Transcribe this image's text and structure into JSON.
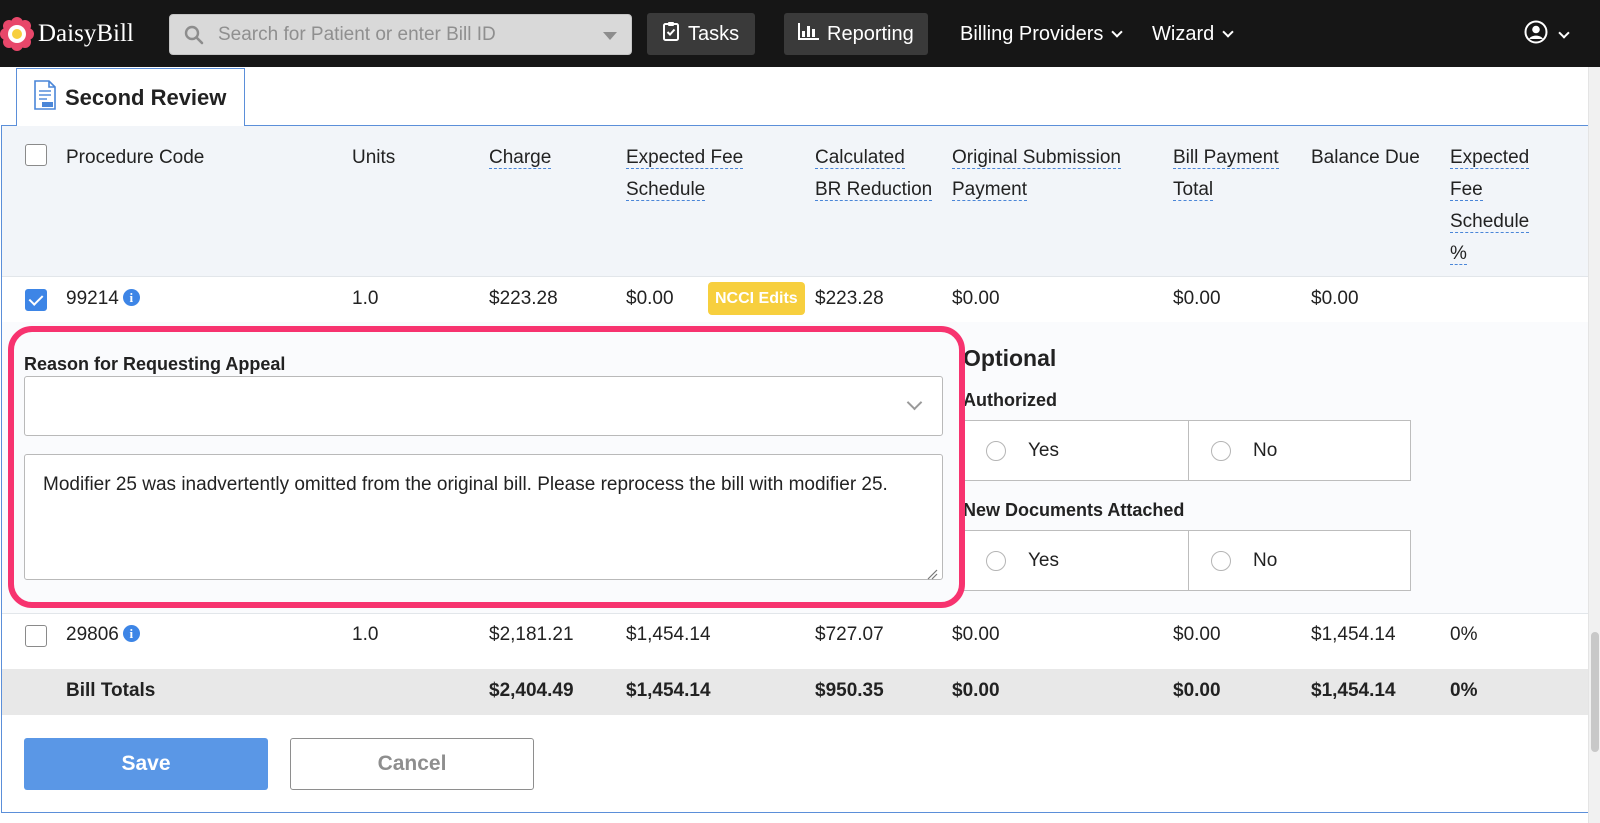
{
  "brand": {
    "name": "DaisyBill"
  },
  "search": {
    "placeholder": "Search for Patient or enter Bill ID"
  },
  "nav": {
    "tasks": "Tasks",
    "reporting": "Reporting",
    "billing_providers": "Billing Providers",
    "wizard": "Wizard"
  },
  "tab": {
    "label": "Second Review"
  },
  "table": {
    "headers": {
      "procedure_code": "Procedure Code",
      "units": "Units",
      "charge": "Charge",
      "expected_fee_1": "Expected Fee",
      "expected_fee_2": "Schedule",
      "calc_br_1": "Calculated",
      "calc_br_2": "BR Reduction",
      "orig_sub_1": "Original Submission",
      "orig_sub_2": "Payment",
      "bill_payment_1": "Bill Payment",
      "bill_payment_2": "Total",
      "balance_due": "Balance Due",
      "efs_pct_1": "Expected",
      "efs_pct_2": "Fee",
      "efs_pct_3": "Schedule",
      "efs_pct_4": "%"
    },
    "rows": [
      {
        "code": "99214",
        "checked": true,
        "units": "1.0",
        "charge": "$223.28",
        "expected_fee": "$0.00",
        "badge": "NCCI Edits",
        "calc_br": "$223.28",
        "orig_sub": "$0.00",
        "bill_payment": "$0.00",
        "balance_due": "$0.00",
        "efs_pct": ""
      },
      {
        "code": "29806",
        "checked": false,
        "units": "1.0",
        "charge": "$2,181.21",
        "expected_fee": "$1,454.14",
        "calc_br": "$727.07",
        "orig_sub": "$0.00",
        "bill_payment": "$0.00",
        "balance_due": "$1,454.14",
        "efs_pct": "0%"
      }
    ],
    "totals": {
      "label": "Bill Totals",
      "charge": "$2,404.49",
      "expected_fee": "$1,454.14",
      "calc_br": "$950.35",
      "orig_sub": "$0.00",
      "bill_payment": "$0.00",
      "balance_due": "$1,454.14",
      "efs_pct": "0%"
    }
  },
  "appeal": {
    "reason_label": "Reason for Requesting Appeal",
    "reason_selected": "",
    "note_text": "Modifier 25 was inadvertently omitted from the original bill. Please reprocess the bill with modifier 25."
  },
  "optional": {
    "title": "Optional",
    "authorized_label": "Authorized",
    "new_docs_label": "New Documents Attached",
    "yes": "Yes",
    "no": "No"
  },
  "actions": {
    "save": "Save",
    "cancel": "Cancel"
  },
  "colors": {
    "accent": "#3d85e6",
    "highlight": "#f7336f",
    "badge": "#f7cf3e",
    "nav_bg": "#161616"
  }
}
